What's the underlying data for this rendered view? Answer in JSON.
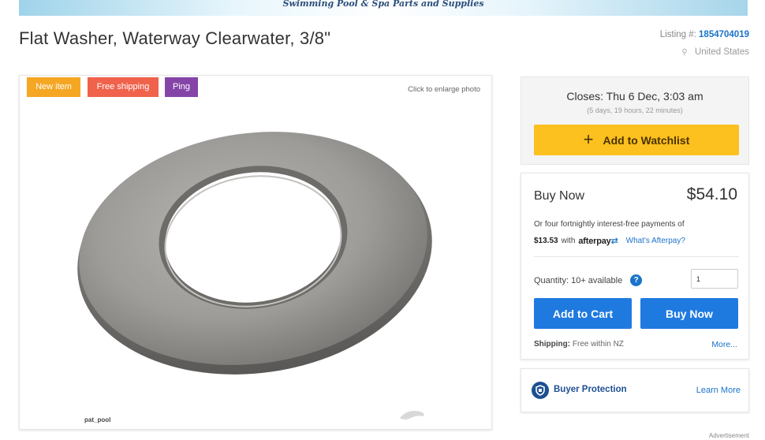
{
  "banner": {
    "text": "Swimming Pool & Spa Parts and Supplies"
  },
  "listing": {
    "title": "Flat Washer, Waterway Clearwater, 3/8\"",
    "number_label": "Listing #:",
    "number": "1854704019",
    "location": "United States"
  },
  "photo": {
    "badges": [
      "New item",
      "Free shipping",
      "Ping"
    ],
    "enlarge_hint": "Click to enlarge photo",
    "watermark": "pat_pool"
  },
  "auction": {
    "closes": "Closes: Thu 6 Dec, 3:03 am",
    "remaining": "(5 days, 19 hours, 22 minutes)",
    "watchlist_label": "Add to Watchlist"
  },
  "buy": {
    "label": "Buy Now",
    "price": "$54.10",
    "afterpay_line1": "Or four fortnightly interest-free payments of",
    "afterpay_amount": "$13.53",
    "afterpay_with": "with",
    "afterpay_brand_a": "afterpay",
    "afterpay_brand_b": "⇄",
    "afterpay_link": "What's Afterpay?",
    "quantity_label": "Quantity: 10+ available",
    "quantity_value": "1",
    "add_to_cart": "Add to Cart",
    "buy_now": "Buy Now",
    "shipping_label": "Shipping:",
    "shipping_value": "Free within NZ",
    "more_link": "More..."
  },
  "protection": {
    "label": "Buyer Protection",
    "learn_more": "Learn More"
  },
  "advertisement": "Advertisement",
  "colors": {
    "accent_blue": "#1f7ae0",
    "watchlist_yellow": "#fcc01f",
    "badge_new": "#f5a623",
    "badge_shipping": "#f0624c",
    "badge_ping": "#8545a8"
  }
}
